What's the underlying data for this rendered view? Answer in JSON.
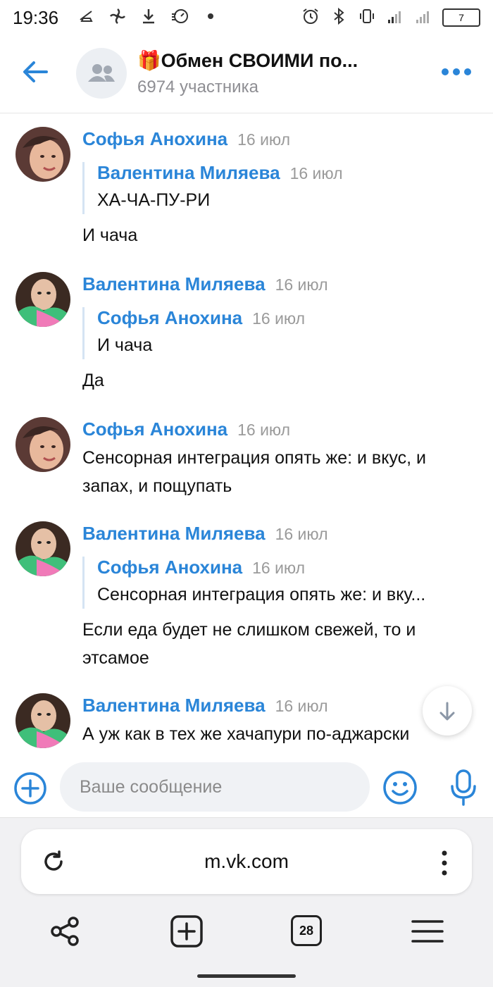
{
  "status_bar": {
    "time": "19:36",
    "battery": "7",
    "icons": [
      "cleaner-icon",
      "fan-icon",
      "download-icon",
      "speed-icon",
      "dot-icon",
      "alarm-icon",
      "bluetooth-icon",
      "vibrate-icon",
      "signal-icon",
      "battery-icon"
    ]
  },
  "header": {
    "title": "🎁Обмен СВОИМИ по...",
    "subtitle": "6974 участника"
  },
  "messages": [
    {
      "author": "Софья Анохина",
      "date": "16 июл",
      "quote": {
        "author": "Валентина Миляева",
        "date": "16 июл",
        "text": "ХА-ЧА-ПУ-РИ"
      },
      "text": "И чача"
    },
    {
      "author": "Валентина Миляева",
      "date": "16 июл",
      "quote": {
        "author": "Софья Анохина",
        "date": "16 июл",
        "text": "И чача"
      },
      "text": "Да"
    },
    {
      "author": "Софья Анохина",
      "date": "16 июл",
      "text": "Сенсорная интеграция опять же: и вкус, и запах, и пощупать"
    },
    {
      "author": "Валентина Миляева",
      "date": "16 июл",
      "quote": {
        "author": "Софья Анохина",
        "date": "16 июл",
        "text": "Сенсорная интеграция опять же: и вку..."
      },
      "text": "Если еда будет не слишком свежей, то и этсамое"
    },
    {
      "author": "Валентина Миляева",
      "date": "16 июл",
      "text": "А уж как в тех же хачапури по-аджарски"
    }
  ],
  "composer": {
    "placeholder": "Ваше сообщение"
  },
  "browser": {
    "url": "m.vk.com",
    "tabs_count": "28"
  },
  "colors": {
    "accent": "#2a85d8",
    "muted": "#9a9a9a"
  }
}
